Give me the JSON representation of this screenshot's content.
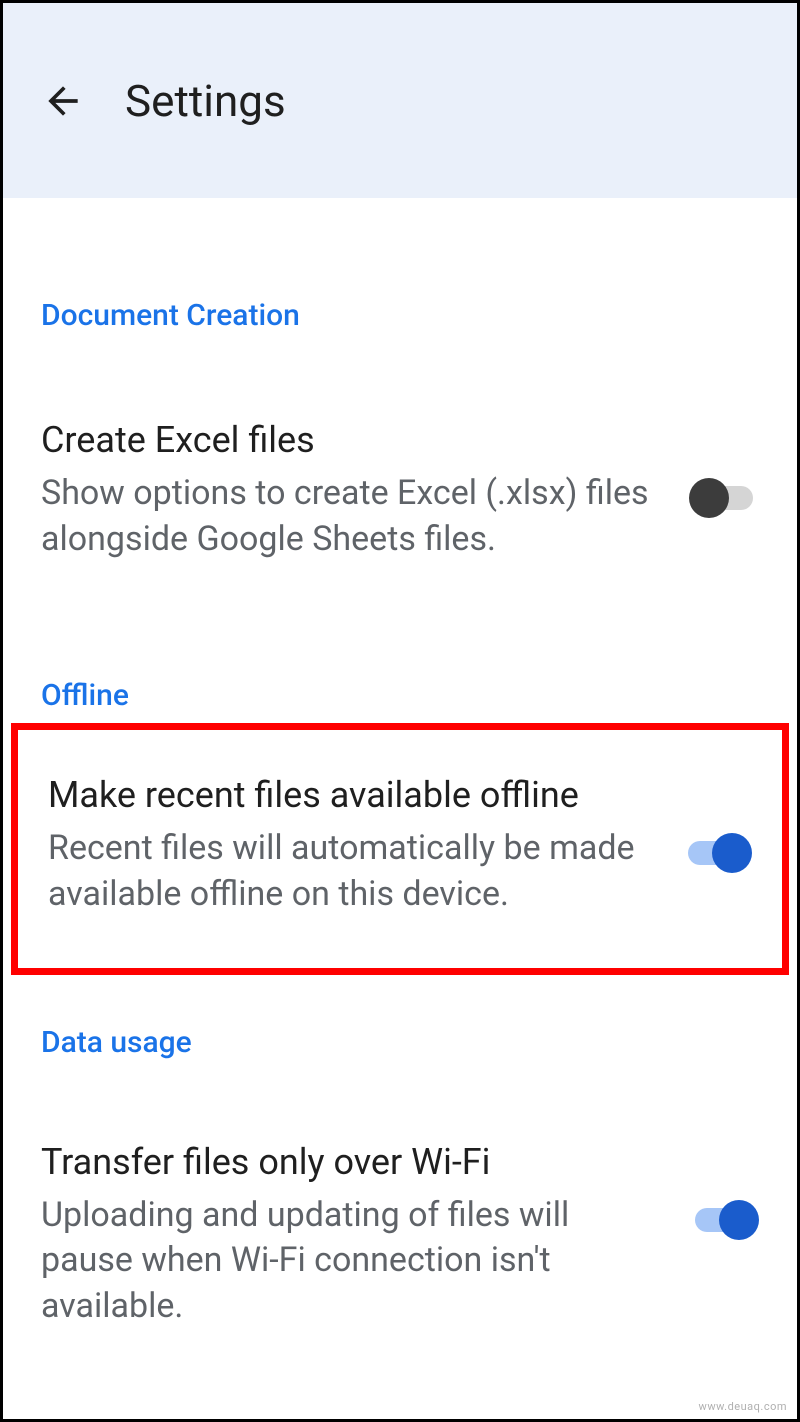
{
  "header": {
    "title": "Settings"
  },
  "sections": {
    "documentCreation": {
      "header": "Document Creation",
      "item": {
        "title": "Create Excel files",
        "desc": "Show options to create Excel (.xlsx) files alongside Google Sheets files.",
        "enabled": false
      }
    },
    "offline": {
      "header": "Offline",
      "item": {
        "title": "Make recent files available offline",
        "desc": "Recent files will automatically be made available offline on this device.",
        "enabled": true
      }
    },
    "dataUsage": {
      "header": "Data usage",
      "item": {
        "title": "Transfer files only over Wi-Fi",
        "desc": "Uploading and updating of files will pause when Wi-Fi connection isn't available.",
        "enabled": true
      }
    }
  },
  "watermark": "www.deuaq.com"
}
